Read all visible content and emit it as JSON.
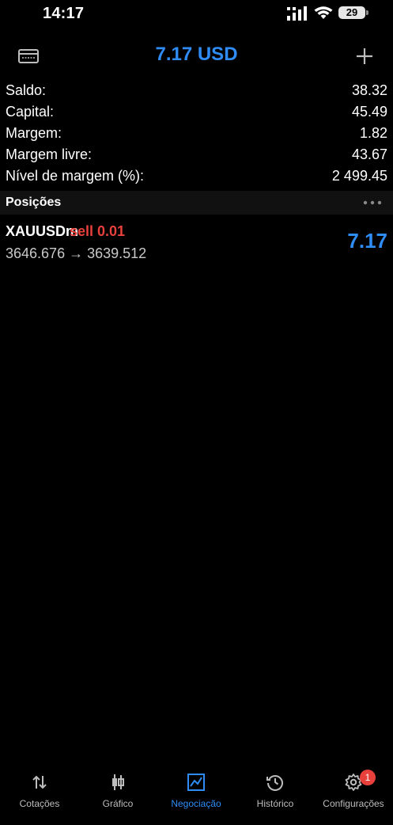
{
  "status_bar": {
    "time": "14:17",
    "battery": "29"
  },
  "header": {
    "title": "7.17 USD",
    "left_icon": "wallet-icon",
    "right_icon": "plus-icon"
  },
  "summary": [
    {
      "label": "Saldo:",
      "value": "38.32"
    },
    {
      "label": "Capital:",
      "value": "45.49"
    },
    {
      "label": "Margem:",
      "value": "1.82"
    },
    {
      "label": "Margem livre:",
      "value": "43.67"
    },
    {
      "label": "Nível de margem (%):",
      "value": "2 499.45"
    }
  ],
  "positions": {
    "title": "Posições",
    "items": [
      {
        "symbol": "XAUUSDm",
        "side": "sell 0.01",
        "prices": "3646.676 → 3639.512",
        "profit": "7.17"
      }
    ]
  },
  "tabs": [
    {
      "label": "Cotações",
      "icon": "quotes-arrows-icon"
    },
    {
      "label": "Gráfico",
      "icon": "chart-candles-icon"
    },
    {
      "label": "Negociação",
      "icon": "trade-chart-icon",
      "active": true
    },
    {
      "label": "Histórico",
      "icon": "history-clock-icon"
    },
    {
      "label": "Configurações",
      "icon": "settings-gear-icon",
      "badge": "1"
    }
  ],
  "colors": {
    "accent": "#2f8cf5",
    "sell": "#e8413c",
    "background": "#000000"
  }
}
